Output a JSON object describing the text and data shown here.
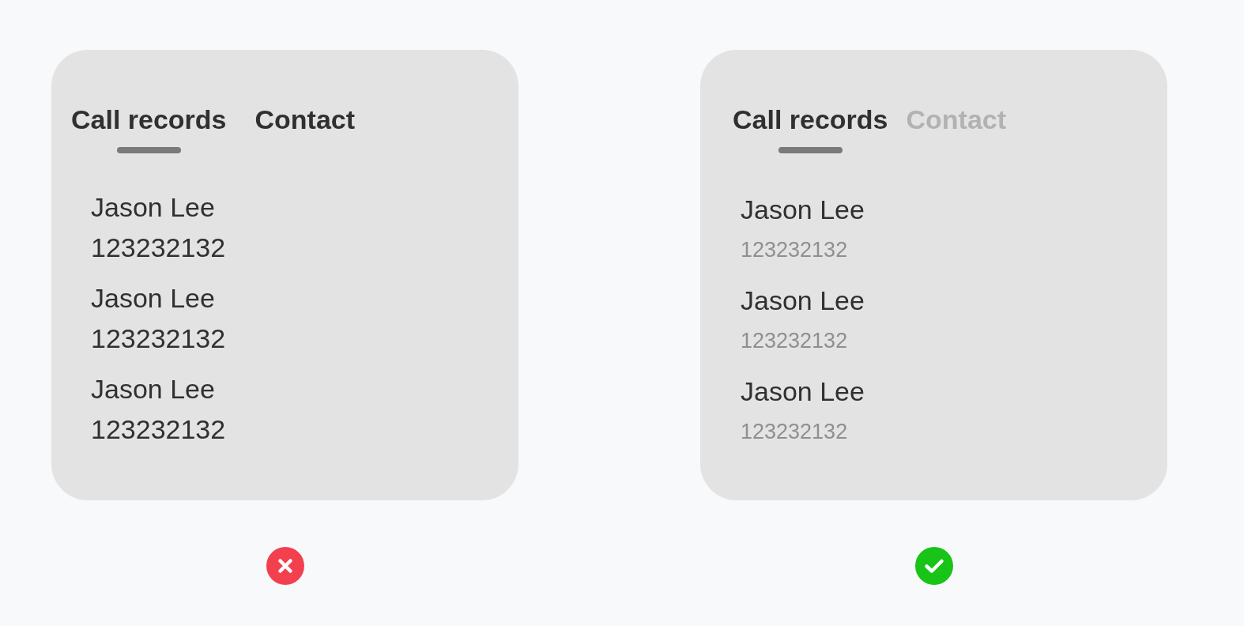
{
  "panels": [
    {
      "kind": "wrong",
      "tabs": [
        {
          "label": "Call records",
          "selected": true,
          "dimmed": false
        },
        {
          "label": "Contact",
          "selected": false,
          "dimmed": false
        }
      ],
      "contacts": [
        {
          "name": "Jason Lee",
          "number": "123232132",
          "muted": false
        },
        {
          "name": "Jason Lee",
          "number": "123232132",
          "muted": false
        },
        {
          "name": "Jason Lee",
          "number": "123232132",
          "muted": false
        }
      ]
    },
    {
      "kind": "right",
      "tabs": [
        {
          "label": "Call records",
          "selected": true,
          "dimmed": false
        },
        {
          "label": "Contact",
          "selected": false,
          "dimmed": true
        }
      ],
      "contacts": [
        {
          "name": "Jason Lee",
          "number": "123232132",
          "muted": true
        },
        {
          "name": "Jason Lee",
          "number": "123232132",
          "muted": true
        },
        {
          "name": "Jason Lee",
          "number": "123232132",
          "muted": true
        }
      ]
    }
  ]
}
